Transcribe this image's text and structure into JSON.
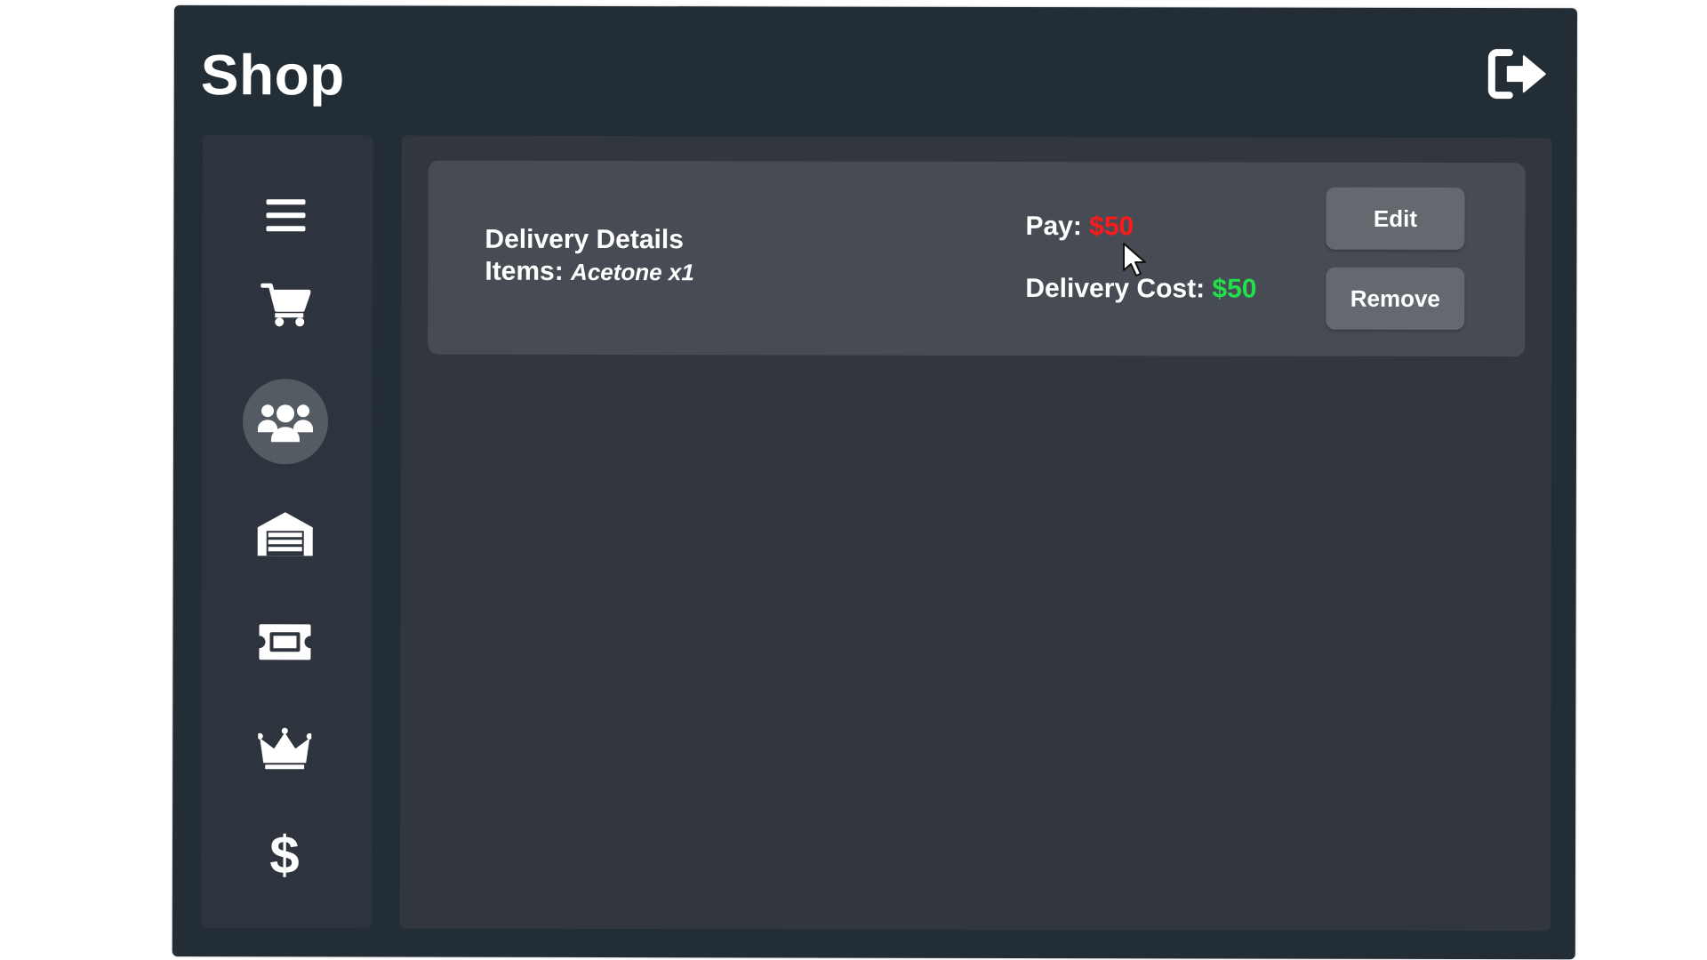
{
  "window": {
    "title": "Shop"
  },
  "header": {
    "exit_icon": "sign-out-icon"
  },
  "sidebar": {
    "items": [
      {
        "icon": "menu-icon",
        "active": false
      },
      {
        "icon": "cart-icon",
        "active": false
      },
      {
        "icon": "users-icon",
        "active": true
      },
      {
        "icon": "garage-icon",
        "active": false
      },
      {
        "icon": "ticket-icon",
        "active": false
      },
      {
        "icon": "crown-icon",
        "active": false
      },
      {
        "icon": "dollar-icon",
        "active": false,
        "glyph": "$"
      }
    ]
  },
  "delivery": {
    "title": "Delivery Details",
    "items_label": "Items:",
    "items_value": "Acetone x1",
    "pay_label": "Pay:",
    "pay_value": "$50",
    "cost_label": "Delivery Cost:",
    "cost_value": "$50",
    "edit_label": "Edit",
    "remove_label": "Remove"
  },
  "colors": {
    "window_bg": "#232d36",
    "sidebar_bg": "#2d343d",
    "panel_bg": "#31363f",
    "card_bg": "#474c54",
    "button_bg": "#64686f",
    "active_nav_bg": "#555b63",
    "pay_value": "#ff1a1a",
    "cost_value": "#22e04a"
  }
}
